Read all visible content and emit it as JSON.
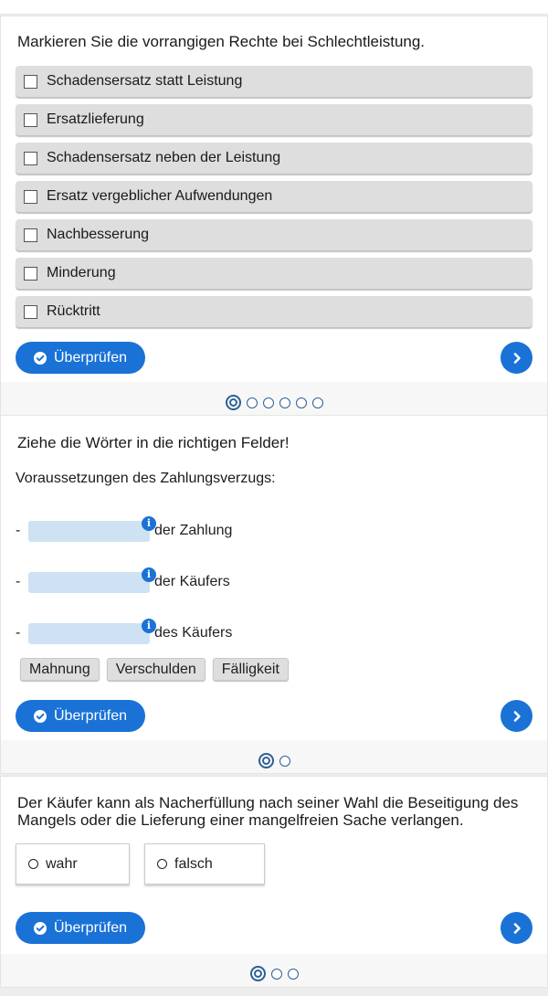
{
  "section1": {
    "question": "Markieren Sie die vorrangigen Rechte bei Schlechtleistung.",
    "options": [
      "Schadensersatz statt Leistung",
      "Ersatzlieferung",
      "Schadensersatz neben der Leistung",
      "Ersatz vergeblicher Aufwendungen",
      "Nachbesserung",
      "Minderung",
      "Rücktritt"
    ],
    "check_label": "Überprüfen",
    "pagination": {
      "total": 6,
      "current": 1
    }
  },
  "section2": {
    "question": "Ziehe die Wörter in die richtigen Felder!",
    "intro": "Voraussetzungen des Zahlungsverzugs:",
    "rows": [
      {
        "prefix": "-",
        "suffix": "der Zahlung"
      },
      {
        "prefix": "-",
        "suffix": "der Käufers"
      },
      {
        "prefix": "-",
        "suffix": "des Käufers"
      }
    ],
    "info_glyph": "i",
    "words": [
      "Mahnung",
      "Verschulden",
      "Fälligkeit"
    ],
    "check_label": "Überprüfen",
    "pagination": {
      "total": 2,
      "current": 1
    }
  },
  "section3": {
    "question": "Der Käufer kann als Nacherfüllung nach seiner Wahl die Beseitigung des Mangels oder die Lieferung einer mangelfreien Sache verlangen.",
    "options": [
      "wahr",
      "falsch"
    ],
    "check_label": "Überprüfen",
    "pagination": {
      "total": 3,
      "current": 1
    }
  },
  "colors": {
    "accent": "#1a72d6",
    "option_bg": "#dedede",
    "drop_bg": "#cfe2f3"
  },
  "icons": {
    "check": "check-circle-icon",
    "next": "chevron-right-icon",
    "info": "info-icon"
  }
}
